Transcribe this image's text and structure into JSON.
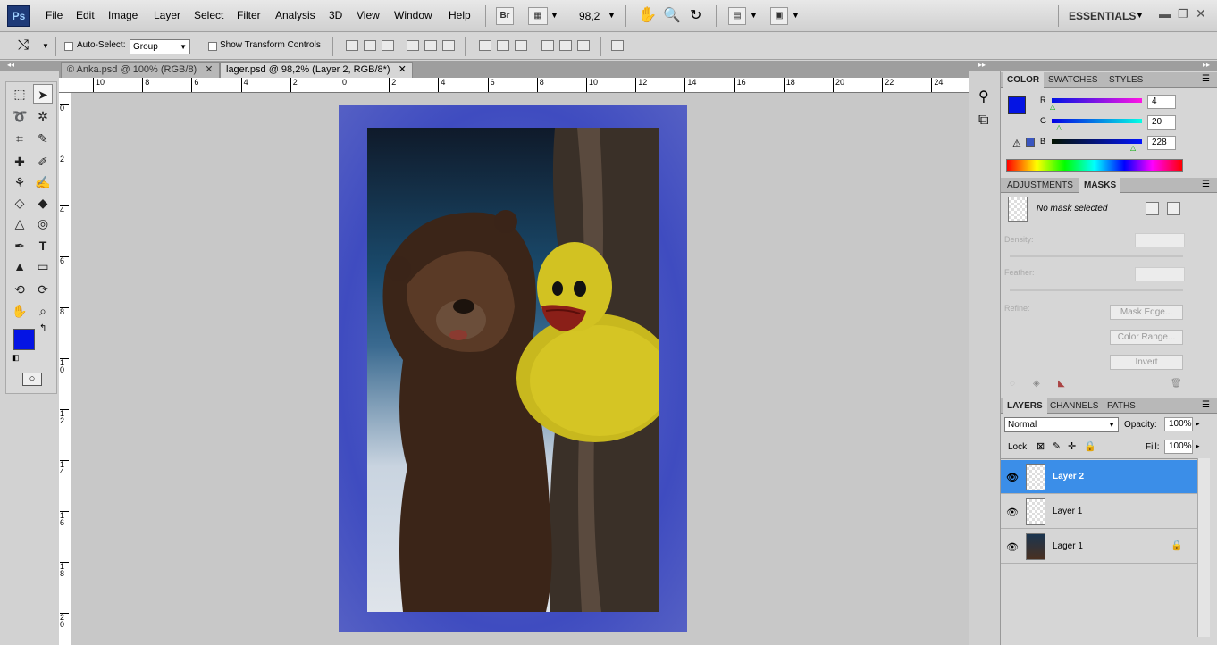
{
  "app": {
    "logo": "Ps",
    "workspace": "ESSENTIALS"
  },
  "menu": [
    "File",
    "Edit",
    "Image",
    "Layer",
    "Select",
    "Filter",
    "Analysis",
    "3D",
    "View",
    "Window",
    "Help"
  ],
  "toolbar": {
    "bridge": "Br",
    "zoom": "98,2"
  },
  "options": {
    "auto_select_label": "Auto-Select:",
    "auto_select_value": "Group",
    "transform_label": "Show Transform Controls"
  },
  "tabs": [
    {
      "label": "© Anka.psd @ 100% (RGB/8)"
    },
    {
      "label": "lager.psd @ 98,2% (Layer 2, RGB/8*)"
    }
  ],
  "ruler": {
    "h": [
      "10",
      "8",
      "6",
      "4",
      "2",
      "0",
      "2",
      "4",
      "6",
      "8",
      "10",
      "12",
      "14",
      "16",
      "18",
      "20",
      "22",
      "24"
    ],
    "v": [
      "0",
      "2",
      "4",
      "6",
      "8",
      "1 0",
      "1 2",
      "1 4",
      "1 6",
      "1 8",
      "2 0"
    ]
  },
  "color_panel": {
    "tabs": [
      "COLOR",
      "SWATCHES",
      "STYLES"
    ],
    "r_label": "R",
    "g_label": "G",
    "b_label": "B",
    "r": "4",
    "g": "20",
    "b": "228",
    "fg_color": "#0414e4"
  },
  "masks_panel": {
    "tabs": [
      "ADJUSTMENTS",
      "MASKS"
    ],
    "status": "No mask selected",
    "density_label": "Density:",
    "feather_label": "Feather:",
    "refine_label": "Refine:",
    "mask_edge": "Mask Edge...",
    "color_range": "Color Range...",
    "invert": "Invert"
  },
  "layers_panel": {
    "tabs": [
      "LAYERS",
      "CHANNELS",
      "PATHS"
    ],
    "blend_mode": "Normal",
    "opacity_label": "Opacity:",
    "opacity": "100%",
    "lock_label": "Lock:",
    "fill_label": "Fill:",
    "fill": "100%",
    "layers": [
      {
        "name": "Layer 2",
        "selected": true
      },
      {
        "name": "Layer 1",
        "selected": false
      },
      {
        "name": "Lager 1",
        "selected": false
      }
    ]
  }
}
